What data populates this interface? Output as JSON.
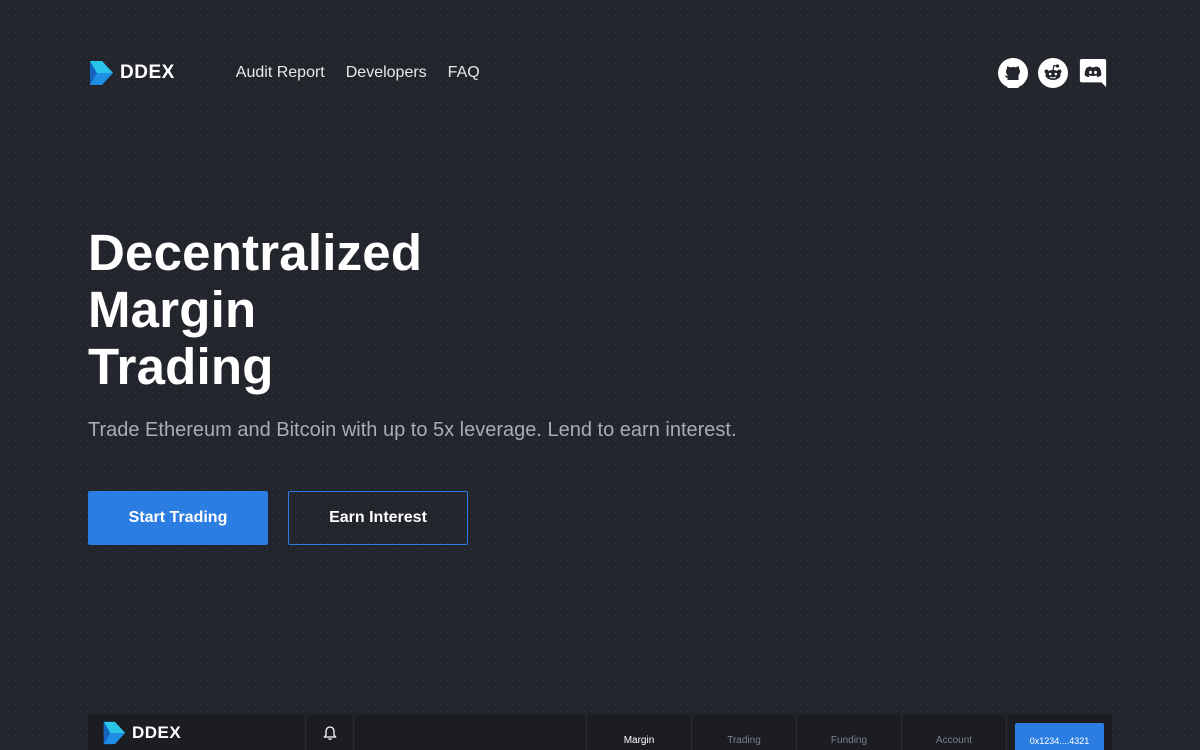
{
  "brand": {
    "name": "DDEX"
  },
  "nav": {
    "links": [
      {
        "label": "Audit Report"
      },
      {
        "label": "Developers"
      },
      {
        "label": "FAQ"
      }
    ],
    "social": [
      "github-icon",
      "reddit-icon",
      "discord-icon"
    ]
  },
  "hero": {
    "title_lines": [
      "Decentralized",
      "Margin",
      "Trading"
    ],
    "subtitle": "Trade Ethereum and Bitcoin with up to 5x leverage. Lend to earn interest.",
    "primary_cta": "Start Trading",
    "secondary_cta": "Earn Interest"
  },
  "app_preview": {
    "brand": "DDEX",
    "tabs": [
      {
        "label": "Margin",
        "active": true
      },
      {
        "label": "Trading",
        "active": false
      },
      {
        "label": "Funding",
        "active": false
      },
      {
        "label": "Account",
        "active": false
      }
    ],
    "account_address": "0x1234....4321"
  },
  "colors": {
    "background": "#23252c",
    "accent": "#2b7de1",
    "subtitle": "#a9acb4"
  }
}
